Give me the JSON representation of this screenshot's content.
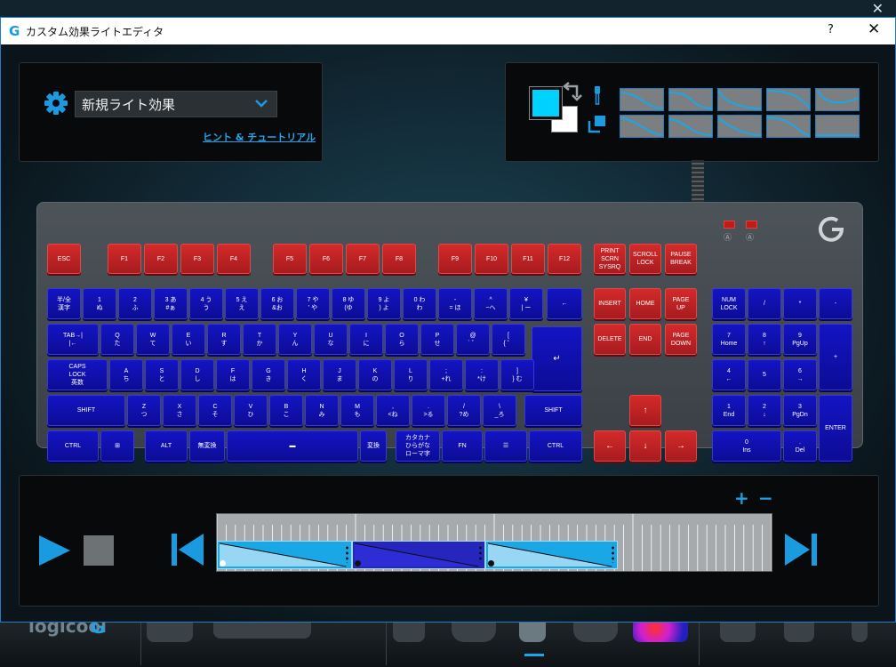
{
  "window": {
    "title": "カスタム効果ライトエディタ",
    "help_label": "?",
    "close_label": "✕",
    "app_icon": "logitech-g-icon"
  },
  "effect": {
    "name": "新規ライト効果",
    "hint_link": "ヒント & チュートリアル"
  },
  "colors": {
    "accent": "#1a9be0",
    "primary_swatch": "#00d2ff",
    "secondary_swatch": "#ffffff",
    "key_red": "#c62226",
    "key_blue": "#1212b4"
  },
  "curves": {
    "count": 10
  },
  "keyboard": {
    "fkeys": [
      "ESC",
      "F1",
      "F2",
      "F3",
      "F4",
      "F5",
      "F6",
      "F7",
      "F8",
      "F9",
      "F10",
      "F11",
      "F12"
    ],
    "sys_keys": [
      "PRINT\nSCRN\nSYSRQ",
      "SCROLL\nLOCK",
      "PAUSE\nBREAK"
    ],
    "row1": [
      "半/全\n漢字",
      "1\nぬ",
      "2\nふ",
      "3 あ\n#ぁ",
      "4 う\nう",
      "5 え\nえ",
      "6 お\n&お",
      "7 や\n' や",
      "8 ゆ\n(ゆ",
      "9 よ\n) よ",
      "0 わ\nわ",
      "-\n= ほ",
      "^\n~へ",
      "¥\n| ー",
      "←"
    ],
    "row2": [
      "TAB→|\n|←",
      "Q\nた",
      "W\nて",
      "E\nい",
      "R\nす",
      "T\nか",
      "Y\nん",
      "U\nな",
      "I\nに",
      "O\nら",
      "P\nせ",
      "@\n` ゛",
      "[\n{ ゜"
    ],
    "row3": [
      "CAPS\nLOCK\n英数",
      "A\nち",
      "S\nと",
      "D\nし",
      "F\nは",
      "G\nき",
      "H\nく",
      "J\nま",
      "K\nの",
      "L\nり",
      ";\n+れ",
      ":\n*け",
      "]\n} む"
    ],
    "row4": [
      "SHIFT",
      "Z\nつ",
      "X\nさ",
      "C\nそ",
      "V\nひ",
      "B\nこ",
      "N\nみ",
      "M\nも",
      ",\n<ね",
      ".\n>る",
      "/\n?め",
      "\\\n_ろ",
      "SHIFT"
    ],
    "row5": [
      "CTRL",
      "⊞",
      "ALT",
      "無変換",
      "▬",
      "変換",
      "カタカナ\nひらがな\nローマ字",
      "FN",
      "☰",
      "CTRL"
    ],
    "enter_label": "↵",
    "nav_keys": [
      "INSERT",
      "HOME",
      "PAGE\nUP",
      "DELETE",
      "END",
      "PAGE\nDOWN"
    ],
    "arrows": [
      "↑",
      "←",
      "↓",
      "→"
    ],
    "numpad": [
      "NUM\nLOCK",
      "/",
      "*",
      "-",
      "7\nHome",
      "8\n↑",
      "9\nPgUp",
      "4\n←",
      "5",
      "6\n→",
      "+",
      "1\nEnd",
      "2\n↓",
      "3\nPgDn",
      "0\nIns",
      ".\nDel",
      "ENTER"
    ],
    "indicators": [
      "Ⓐ",
      "Ⓐ"
    ]
  },
  "timeline": {
    "zoom_in_label": "+",
    "zoom_out_label": "−",
    "segments": [
      {
        "fill": "#1aa7e6",
        "start": 0.0,
        "end": 0.245
      },
      {
        "fill": "#2626bf",
        "start": 0.245,
        "end": 0.485
      },
      {
        "fill": "#1aa7e6",
        "start": 0.485,
        "end": 0.725
      }
    ]
  },
  "bottom_bar": {
    "logo_text": "logicool",
    "logo_g": "G"
  }
}
